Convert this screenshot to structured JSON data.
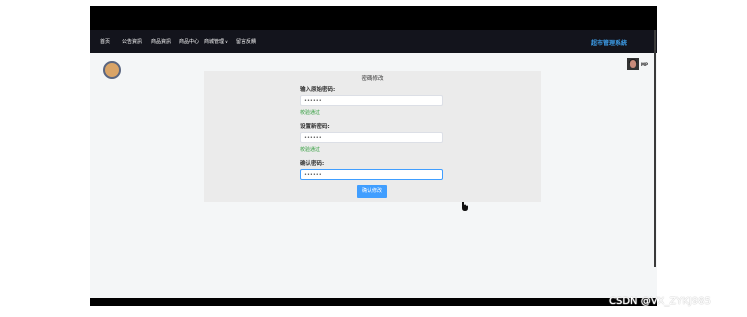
{
  "nav": {
    "items": [
      "首页",
      "公告資訊",
      "商品資訊",
      "商品中心",
      "商城管理",
      "留言反饋"
    ],
    "brand": "超市管理系統"
  },
  "user": {
    "name": "MP"
  },
  "form": {
    "title": "密碼修改",
    "fields": [
      {
        "label": "输入原始密码:",
        "value": "••••••",
        "validation": "校验通过"
      },
      {
        "label": "设置新密码:",
        "value": "••••••",
        "validation": "校验通过"
      },
      {
        "label": "确认密码:",
        "value": "••••••",
        "validation": ""
      }
    ],
    "submit_label": "确认修改"
  },
  "watermark": "CSDN @VX_ZYKJ985",
  "colors": {
    "nav_bg": "#13141c",
    "brand": "#3d9de8",
    "primary": "#409eff",
    "valid": "#2e9c3a"
  }
}
